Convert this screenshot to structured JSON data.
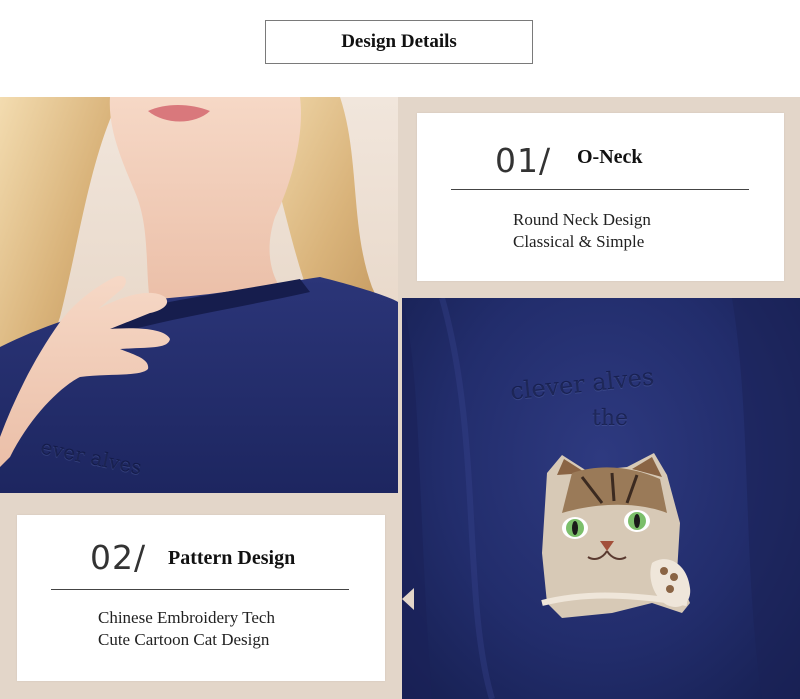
{
  "header": {
    "title": "Design Details"
  },
  "features": [
    {
      "number": "01/",
      "title": "O-Neck",
      "lines": [
        "Round Neck Design",
        "Classical & Simple"
      ]
    },
    {
      "number": "02/",
      "title": "Pattern Design",
      "lines": [
        "Chinese Embroidery Tech",
        "Cute Cartoon Cat Design"
      ]
    }
  ],
  "embroidery": {
    "right_line1": "clever alves",
    "right_line2": "the",
    "left_line": "ever alves"
  },
  "colors": {
    "frame": "#e3d6c9",
    "fabric": "#222d6c",
    "card": "#ffffff"
  }
}
